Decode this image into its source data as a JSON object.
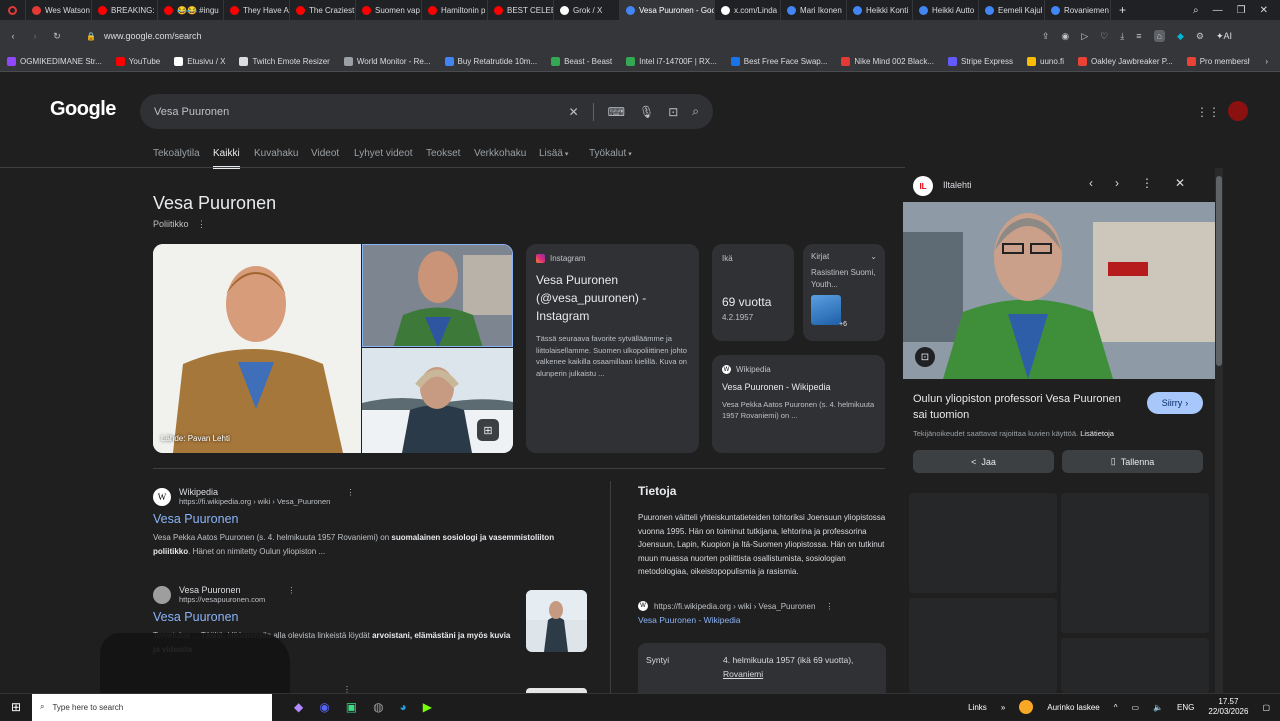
{
  "browser": {
    "tabs": [
      {
        "label": "Wes Watson",
        "color": "#e53935"
      },
      {
        "label": "BREAKING: J",
        "color": "#ff0000"
      },
      {
        "label": "😂😂 #ingu",
        "color": "#ff0000"
      },
      {
        "label": "They Have A",
        "color": "#ff0000"
      },
      {
        "label": "The Craziest",
        "color": "#ff0000"
      },
      {
        "label": "Suomen vap",
        "color": "#ff0000"
      },
      {
        "label": "Hamiltonin p",
        "color": "#ff0000"
      },
      {
        "label": "BEST CELEBR",
        "color": "#ff0000"
      },
      {
        "label": "Grok / X",
        "color": "#ffffff"
      },
      {
        "label": "Vesa Puuronen - Goo",
        "color": "#4285f4"
      },
      {
        "label": "x.com/Linda",
        "color": "#ffffff"
      },
      {
        "label": "Mari Ikonen",
        "color": "#4285f4"
      },
      {
        "label": "Heikki Konti",
        "color": "#4285f4"
      },
      {
        "label": "Heikki Autto",
        "color": "#4285f4"
      },
      {
        "label": "Eemeli Kajul",
        "color": "#4285f4"
      },
      {
        "label": "Rovaniemen",
        "color": "#4285f4"
      }
    ],
    "active_tab": 9,
    "new_tab": "+",
    "url": "www.google.com/search",
    "ai_label": "AI",
    "bookmarks": [
      {
        "label": "OGMIKEDIMANE Str...",
        "color": "#9146ff"
      },
      {
        "label": "YouTube",
        "color": "#ff0000"
      },
      {
        "label": "Etusivu / X",
        "color": "#ffffff"
      },
      {
        "label": "Twitch Emote Resizer",
        "color": "#dadce0"
      },
      {
        "label": "World Monitor - Re...",
        "color": "#9aa0a6"
      },
      {
        "label": "Buy Retatrutide 10m...",
        "color": "#4285f4"
      },
      {
        "label": "Beast - Beast",
        "color": "#34a853"
      },
      {
        "label": "Intel i7-14700F | RX...",
        "color": "#34a853"
      },
      {
        "label": "Best Free Face Swap...",
        "color": "#1a73e8"
      },
      {
        "label": "Nike Mind 002 Black...",
        "color": "#e53935"
      },
      {
        "label": "Stripe Express",
        "color": "#635bff"
      },
      {
        "label": "uuno.fi",
        "color": "#fbbc04"
      },
      {
        "label": "Oakley Jawbreaker P...",
        "color": "#ea4335"
      },
      {
        "label": "Pro membership - G...",
        "color": "#ea4335"
      }
    ]
  },
  "google": {
    "logo": "Google",
    "query": "Vesa Puuronen",
    "nav": [
      "Tekoälytila",
      "Kaikki",
      "Kuvahaku",
      "Videot",
      "Lyhyet videot",
      "Teokset",
      "Verkkohaku",
      "Lisää",
      "Työkalut"
    ],
    "entity": {
      "name": "Vesa Puuronen",
      "subtitle": "Poliitikko"
    },
    "image_source": "Lähde: Pavan Lehti",
    "instagram": {
      "source": "Instagram",
      "title": "Vesa Puuronen (@vesa_puuronen) - Instagram",
      "snippet": "Tässä seuraava favorite sytvälläämme ja liittolaisellamme. Suomen ulkopoliittinen johto valkenee kaikilla osaamillaan kielillä. Kuva on alunperin julkaistu ..."
    },
    "age": {
      "label": "Ikä",
      "value": "69 vuotta",
      "date": "4.2.1957"
    },
    "books": {
      "label": "Kirjat",
      "title": "Rasistinen Suomi, Youth...",
      "more": "+6"
    },
    "wiki_card": {
      "source": "Wikipedia",
      "title": "Vesa Puuronen - Wikipedia",
      "snippet": "Vesa Pekka Aatos Puuronen (s. 4. helmikuuta 1957 Rovaniemi) on ..."
    },
    "results": [
      {
        "site": "Wikipedia",
        "url": "https://fi.wikipedia.org › wiki › Vesa_Puuronen",
        "title": "Vesa Puuronen",
        "snippet_a": "Vesa Pekka Aatos Puuronen (s. 4. helmikuuta 1957 Rovaniemi) on ",
        "snippet_b": "suomalainen sosiologi ja vasemmistoliiton poliitikko",
        "snippet_c": ". Hänet on nimitetty Oulun yliopiston ..."
      },
      {
        "site": "Vesa Puuronen",
        "url": "https://vesapuuronen.com",
        "title": "Vesa Puuronen",
        "snippet_a": "Tervetuloa ... Täältä, klikkaamalla alla olevista linkeistä löydät ",
        "snippet_b": "arvoistani, elämästäni ja myös kuvia ja videoita",
        "snippet_c": ""
      }
    ],
    "tietoja": {
      "heading": "Tietoja",
      "text": "Puuronen väitteli yhteiskuntatieteiden tohtoriksi Joensuun yliopistossa vuonna 1995. Hän on toiminut tutkijana, lehtorina ja professorina Joensuun, Lapin, Kuopion ja Itä-Suomen yliopistossa. Hän on tutkinut muun muassa nuorten poliittista osallistumista, sosiologian metodologiaa, oikeistopopulismia ja rasismia.",
      "source_url": "https://fi.wikipedia.org › wiki › Vesa_Puuronen",
      "source_title": "Vesa Puuronen - Wikipedia",
      "born_label": "Syntyi",
      "born_value": "4. helmikuuta 1957 (ikä 69 vuotta),",
      "born_place": "Rovaniemi"
    },
    "preview": {
      "source": "Iltalehti",
      "title": "Oulun yliopiston professori Vesa Puuronen sai tuomion",
      "go": "Siirry",
      "note": "Tekijänoikeudet saattavat rajoittaa kuvien käyttöä. ",
      "note_link": "Lisätietoja",
      "share": "Jaa",
      "save": "Tallenna",
      "logo_letter": "IL"
    }
  },
  "taskbar": {
    "search": "Type here to search",
    "links": "Links",
    "weather": "Aurinko laskee",
    "lang": "ENG",
    "time": "17.57",
    "date": "22/03/2026"
  }
}
